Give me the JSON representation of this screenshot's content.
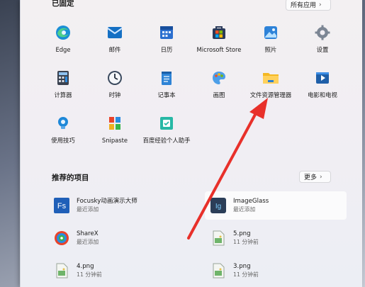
{
  "pinned": {
    "title": "已固定",
    "all_apps_label": "所有应用",
    "apps": [
      {
        "label": "Edge",
        "icon": "edge-icon"
      },
      {
        "label": "邮件",
        "icon": "mail-icon"
      },
      {
        "label": "日历",
        "icon": "calendar-icon"
      },
      {
        "label": "Microsoft Store",
        "icon": "store-icon"
      },
      {
        "label": "照片",
        "icon": "photos-icon"
      },
      {
        "label": "设置",
        "icon": "settings-icon"
      },
      {
        "label": "计算器",
        "icon": "calculator-icon"
      },
      {
        "label": "时钟",
        "icon": "clock-icon"
      },
      {
        "label": "记事本",
        "icon": "notepad-icon"
      },
      {
        "label": "画图",
        "icon": "paint-icon"
      },
      {
        "label": "文件资源管理器",
        "icon": "folder-icon"
      },
      {
        "label": "电影和电视",
        "icon": "movies-icon"
      },
      {
        "label": "使用技巧",
        "icon": "tips-icon"
      },
      {
        "label": "Snipaste",
        "icon": "snipaste-icon"
      },
      {
        "label": "百度经验个人助手",
        "icon": "baidu-helper-icon"
      }
    ]
  },
  "recommended": {
    "title": "推荐的项目",
    "more_label": "更多",
    "items": [
      {
        "name": "Focusky动画演示大师",
        "sub": "最近添加",
        "icon": "focusky-icon"
      },
      {
        "name": "ImageGlass",
        "sub": "最近添加",
        "icon": "imageglass-icon"
      },
      {
        "name": "ShareX",
        "sub": "最近添加",
        "icon": "sharex-icon"
      },
      {
        "name": "5.png",
        "sub": "11 分钟前",
        "icon": "png-file-icon"
      },
      {
        "name": "4.png",
        "sub": "11 分钟前",
        "icon": "png-file-icon"
      },
      {
        "name": "3.png",
        "sub": "11 分钟前",
        "icon": "png-file-icon"
      }
    ]
  },
  "colors": {
    "arrow": "#e8302a",
    "accent": "#0067c0"
  }
}
